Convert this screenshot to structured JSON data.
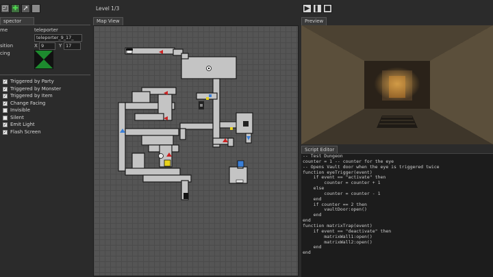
{
  "toolbar": {
    "left_icons": [
      "select-icon",
      "add-icon",
      "pointer-icon",
      "box-icon"
    ],
    "level_label": "Level 1/3",
    "play_icons": [
      "play-icon",
      "pause-icon",
      "stop-icon"
    ]
  },
  "inspector": {
    "tab_label": "spector",
    "name_label": "me",
    "name_value": "teleporter",
    "id_value": "teleporter_9_17_",
    "position_label": "sition",
    "x_label": "X",
    "x_value": "9",
    "y_label": "Y",
    "y_value": "17",
    "facing_label": "cing",
    "options": [
      {
        "label": "Triggered by Party",
        "checked": true
      },
      {
        "label": "Triggered by Monster",
        "checked": true
      },
      {
        "label": "Triggered by Item",
        "checked": true
      },
      {
        "label": "Change Facing",
        "checked": true
      },
      {
        "label": "Invisible",
        "checked": false
      },
      {
        "label": "Silent",
        "checked": false
      },
      {
        "label": "Emit Light",
        "checked": true
      },
      {
        "label": "Flash Screen",
        "checked": true
      }
    ]
  },
  "map": {
    "tab_label": "Map View"
  },
  "preview": {
    "tab_label": "Preview"
  },
  "script": {
    "tab_label": "Script Editor",
    "lines": [
      "-- Test Dungeon",
      "",
      "counter = 1 -- counter for the eye",
      "",
      "-- Opens Vault door when the eye is triggered twice",
      "function eyeTrigger(event)",
      "    if event == \"activate\" then",
      "        counter = counter + 1",
      "    else",
      "        counter = counter - 1",
      "    end",
      "",
      "    if counter == 2 then",
      "        vaultDoor:open()",
      "    end",
      "end",
      "",
      "function matrixTrap(event)",
      "    if event == \"deactivate\" then",
      "        matrixWall1:open()",
      "        matrixWall2:open()",
      "    end",
      "end"
    ]
  },
  "colors": {
    "accent_green": "#2ea043",
    "marker_red": "#cc2222",
    "marker_blue": "#3a7fd8",
    "marker_yellow": "#e8d21a"
  }
}
